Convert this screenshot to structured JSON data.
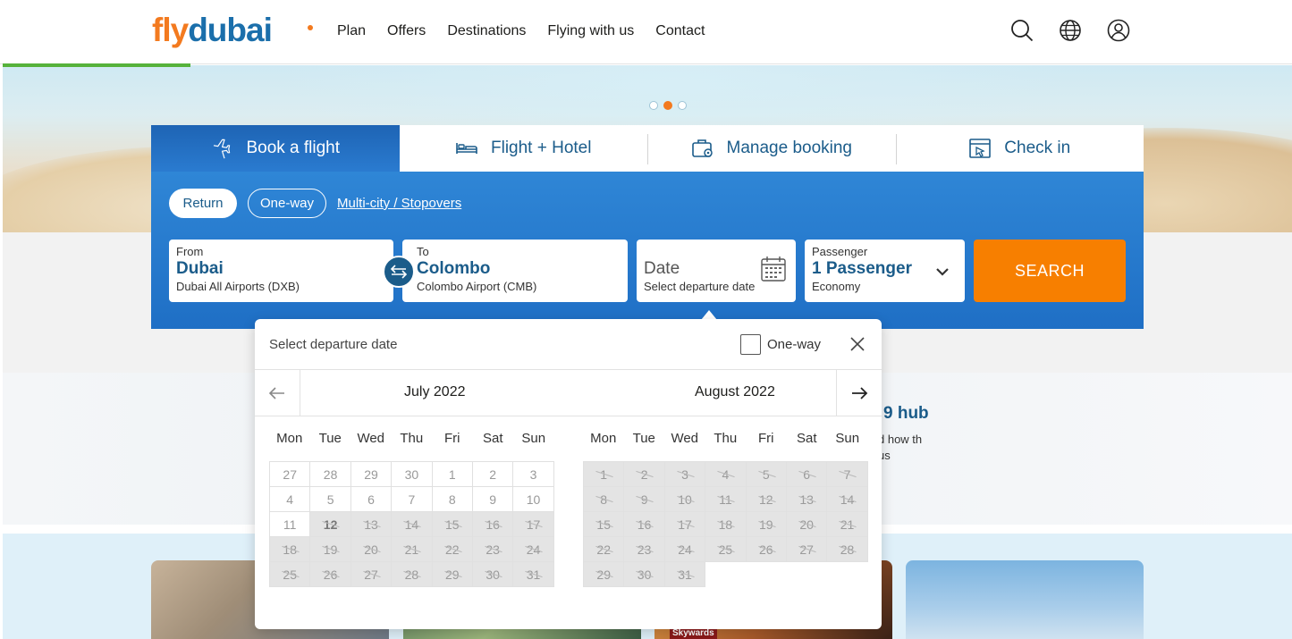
{
  "header": {
    "logo": {
      "fly": "fly",
      "dubai": "dubai"
    },
    "nav": [
      "Plan",
      "Offers",
      "Destinations",
      "Flying with us",
      "Contact"
    ],
    "icons": [
      "search-icon",
      "globe-icon",
      "user-icon"
    ]
  },
  "hero": {
    "slides": 3,
    "active_slide": 2
  },
  "tabs": {
    "book": "Book a flight",
    "hotel": "Flight + Hotel",
    "manage": "Manage booking",
    "checkin": "Check in"
  },
  "trip": {
    "return": "Return",
    "oneway": "One-way",
    "multi": "Multi-city / Stopovers"
  },
  "from": {
    "label": "From",
    "city": "Dubai",
    "airport": "Dubai All Airports (DXB)"
  },
  "to": {
    "label": "To",
    "city": "Colombo",
    "airport": "Colombo Airport (CMB)"
  },
  "date": {
    "label": "Date",
    "sub": "Select departure date"
  },
  "passenger": {
    "label": "Passenger",
    "value": "1 Passenger",
    "cabin": "Economy"
  },
  "search": "SEARCH",
  "promo": {
    "title": "9 hub",
    "text": "d how th us"
  },
  "skywards": "Skywards",
  "picker": {
    "title": "Select departure date",
    "oneway": "One-way",
    "weekdays": [
      "Mon",
      "Tue",
      "Wed",
      "Thu",
      "Fri",
      "Sat",
      "Sun"
    ],
    "months": [
      {
        "name": "July  2022",
        "weeks": [
          [
            "27",
            "28",
            "29",
            "30",
            "1",
            "2",
            "3"
          ],
          [
            "4",
            "5",
            "6",
            "7",
            "8",
            "9",
            "10"
          ],
          [
            "11",
            "12",
            "13",
            "14",
            "15",
            "16",
            "17"
          ],
          [
            "18",
            "19",
            "20",
            "21",
            "22",
            "23",
            "24"
          ],
          [
            "25",
            "26",
            "27",
            "28",
            "29",
            "30",
            "31"
          ]
        ],
        "today": "12"
      },
      {
        "name": "August  2022",
        "weeks": [
          [
            "1",
            "2",
            "3",
            "4",
            "5",
            "6",
            "7"
          ],
          [
            "8",
            "9",
            "10",
            "11",
            "12",
            "13",
            "14"
          ],
          [
            "15",
            "16",
            "17",
            "18",
            "19",
            "20",
            "21"
          ],
          [
            "22",
            "23",
            "24",
            "25",
            "26",
            "27",
            "28"
          ],
          [
            "29",
            "30",
            "31",
            "",
            "",
            "",
            ""
          ]
        ]
      }
    ]
  },
  "colors": {
    "brand_blue": "#1b6fab",
    "brand_orange": "#f37a1f",
    "search_orange": "#f77f00",
    "panel_blue": "#2476cc",
    "progress_green": "#56b23b"
  }
}
